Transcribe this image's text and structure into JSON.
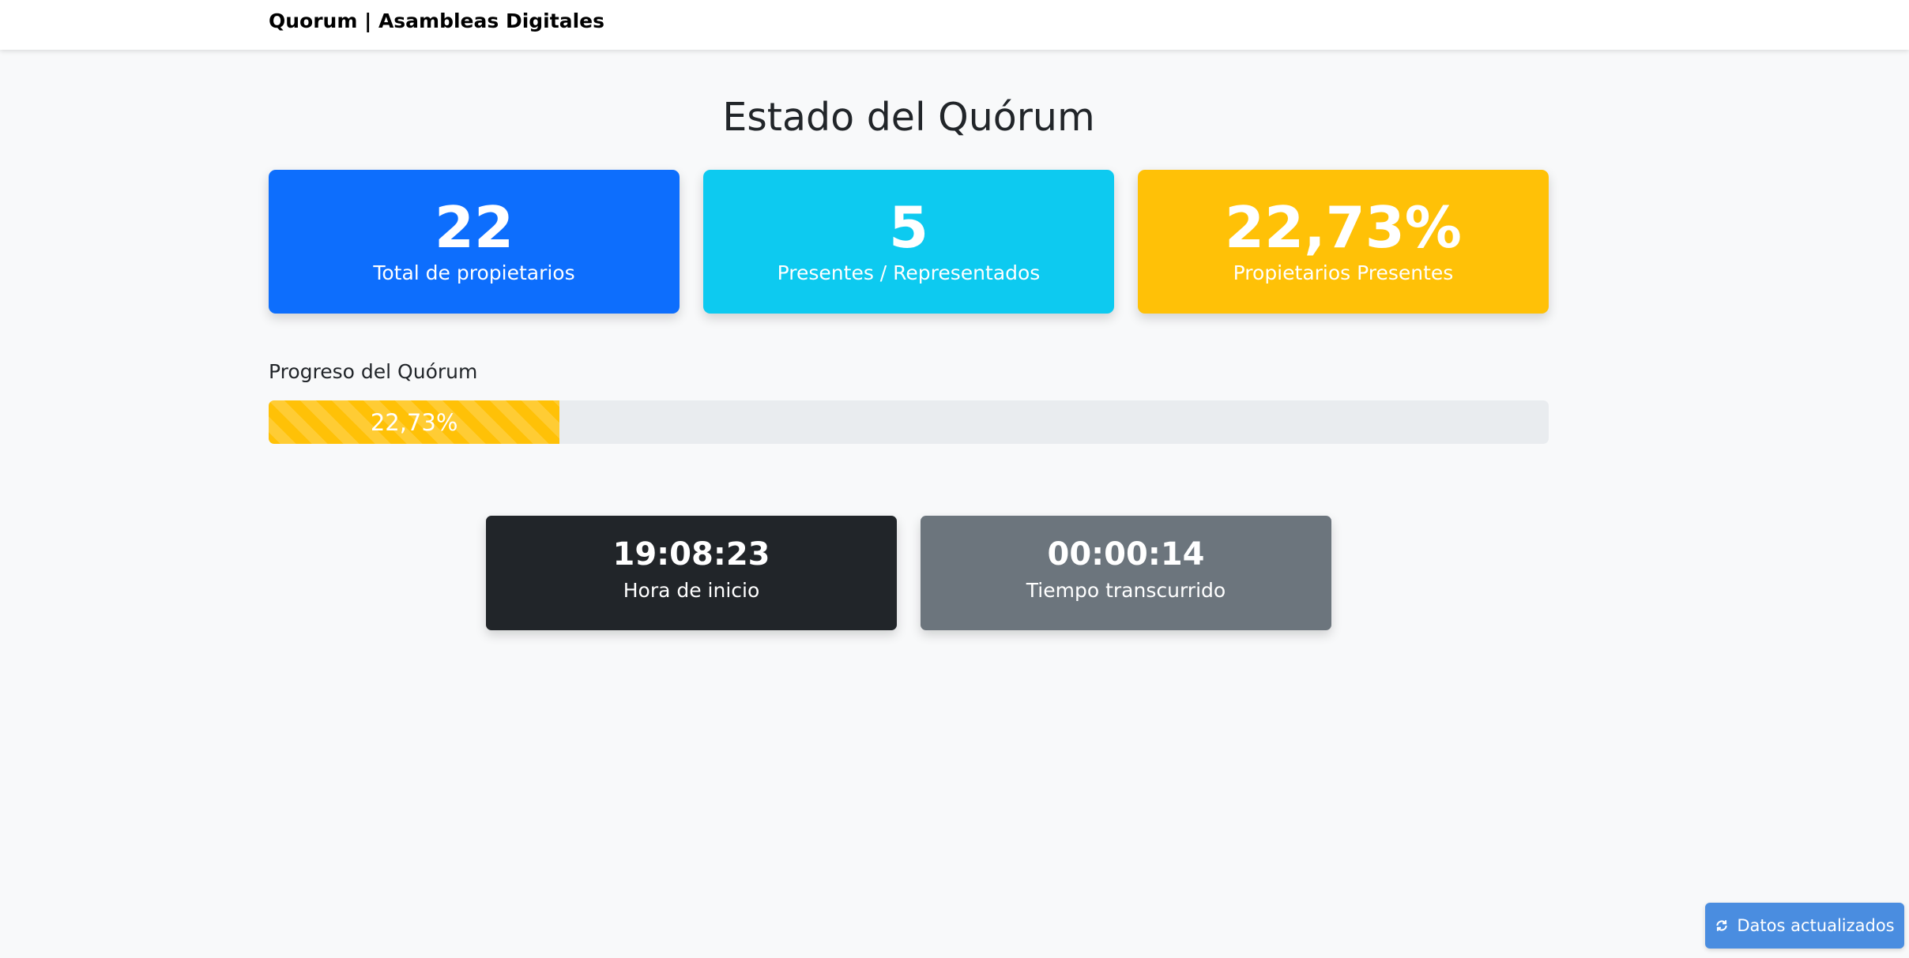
{
  "navbar": {
    "brand": "Quorum | Asambleas Digitales"
  },
  "page": {
    "title": "Estado del Quórum"
  },
  "stats": {
    "total": {
      "value": "22",
      "label": "Total de propietarios",
      "color": "#0d6efd"
    },
    "present": {
      "value": "5",
      "label": "Presentes / Representados",
      "color": "#0dcaf0"
    },
    "percent": {
      "value": "22,73%",
      "label": "Propietarios Presentes",
      "color": "#ffc107"
    }
  },
  "progress": {
    "label": "Progreso del Quórum",
    "value_text": "22,73%",
    "fraction": 0.2273,
    "color": "#ffc107"
  },
  "times": {
    "start": {
      "value": "19:08:23",
      "label": "Hora de inicio",
      "color": "#212529"
    },
    "elapsed": {
      "value": "00:00:14",
      "label": "Tiempo transcurrido",
      "color": "#6c757d"
    }
  },
  "toast": {
    "text": "Datos actualizados",
    "icon": "refresh-icon",
    "color": "#4a8de0"
  }
}
